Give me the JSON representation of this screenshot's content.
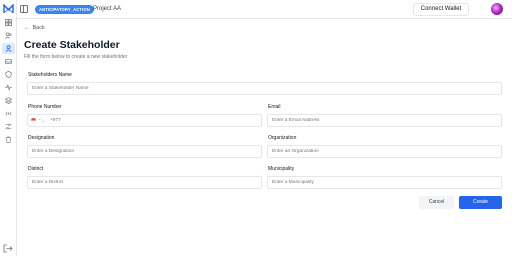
{
  "header": {
    "badge": "ANTICIPATORY_ACTION",
    "project": "Project AA",
    "connect_wallet": "Connect Wallet"
  },
  "sidebar": {
    "icons": [
      "dashboard-icon",
      "users-icon",
      "stakeholders-icon",
      "inbox-icon",
      "shield-icon",
      "activity-icon",
      "layers-icon",
      "broadcast-icon",
      "sliders-icon",
      "trash-icon"
    ],
    "active_index": 2
  },
  "page": {
    "back_label": "Back",
    "title": "Create Stakeholder",
    "subtitle": "Fill the form below to create a new stakeholder"
  },
  "form": {
    "name": {
      "label": "Stakeholders Name",
      "placeholder": "Enter a Stakeholder Name"
    },
    "phone": {
      "label": "Phone Number",
      "code": "+977"
    },
    "email": {
      "label": "Email",
      "placeholder": "Enter a Email Address"
    },
    "designation": {
      "label": "Designation",
      "placeholder": "Enter a Designation"
    },
    "organization": {
      "label": "Organization",
      "placeholder": "Enter an Organization"
    },
    "district": {
      "label": "District",
      "placeholder": "Enter a District"
    },
    "municipality": {
      "label": "Municipality",
      "placeholder": "Enter a Municipality"
    }
  },
  "actions": {
    "cancel": "Cancel",
    "create": "Create"
  },
  "colors": {
    "accent": "#2563eb",
    "badge": "#3b82f6"
  }
}
